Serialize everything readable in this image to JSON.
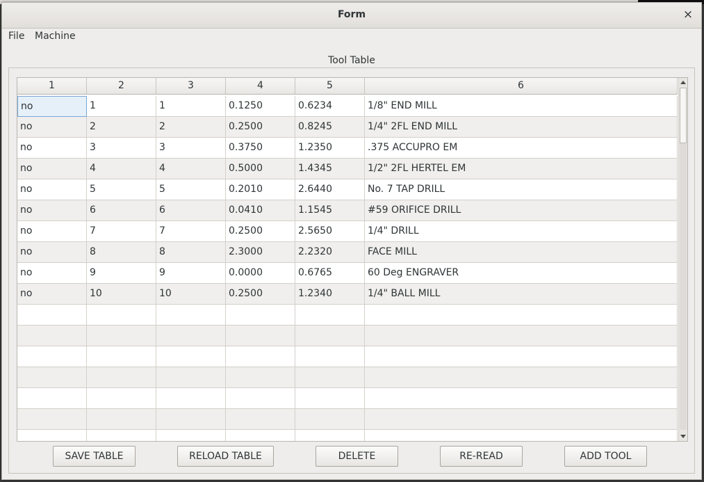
{
  "window": {
    "title": "Form",
    "close_symbol": "×"
  },
  "menu": {
    "items": [
      "File",
      "Machine"
    ]
  },
  "group": {
    "title": "Tool Table"
  },
  "table": {
    "headers": [
      "1",
      "2",
      "3",
      "4",
      "5",
      "6"
    ],
    "rows": [
      [
        "no",
        "1",
        "1",
        "0.1250",
        "0.6234",
        "1/8\" END MILL"
      ],
      [
        "no",
        "2",
        "2",
        "0.2500",
        "0.8245",
        "1/4\" 2FL END MILL"
      ],
      [
        "no",
        "3",
        "3",
        "0.3750",
        "1.2350",
        ".375 ACCUPRO EM"
      ],
      [
        "no",
        "4",
        "4",
        "0.5000",
        "1.4345",
        "1/2\" 2FL HERTEL EM"
      ],
      [
        "no",
        "5",
        "5",
        "0.2010",
        "2.6440",
        "No. 7 TAP DRILL"
      ],
      [
        "no",
        "6",
        "6",
        "0.0410",
        "1.1545",
        "#59 ORIFICE DRILL"
      ],
      [
        "no",
        "7",
        "7",
        "0.2500",
        "2.5650",
        "1/4\" DRILL"
      ],
      [
        "no",
        "8",
        "8",
        "2.3000",
        "2.2320",
        "FACE MILL"
      ],
      [
        "no",
        "9",
        "9",
        "0.0000",
        "0.6765",
        "60 Deg ENGRAVER"
      ],
      [
        "no",
        "10",
        "10",
        "0.2500",
        "1.2340",
        "1/4\" BALL MILL"
      ],
      [
        "",
        "",
        "",
        "",
        "",
        ""
      ],
      [
        "",
        "",
        "",
        "",
        "",
        ""
      ],
      [
        "",
        "",
        "",
        "",
        "",
        ""
      ],
      [
        "",
        "",
        "",
        "",
        "",
        ""
      ],
      [
        "",
        "",
        "",
        "",
        "",
        ""
      ],
      [
        "",
        "",
        "",
        "",
        "",
        ""
      ],
      [
        "",
        "",
        "",
        "",
        "",
        ""
      ]
    ],
    "selected_cell": {
      "row": 0,
      "col": 0
    }
  },
  "buttons": {
    "save": "SAVE TABLE",
    "reload": "RELOAD TABLE",
    "delete": "DELETE",
    "reread": "RE-READ",
    "add": "ADD TOOL"
  },
  "icons": {
    "close": "close-icon",
    "scroll_up": "arrow-up-icon",
    "scroll_down": "arrow-down-icon"
  }
}
